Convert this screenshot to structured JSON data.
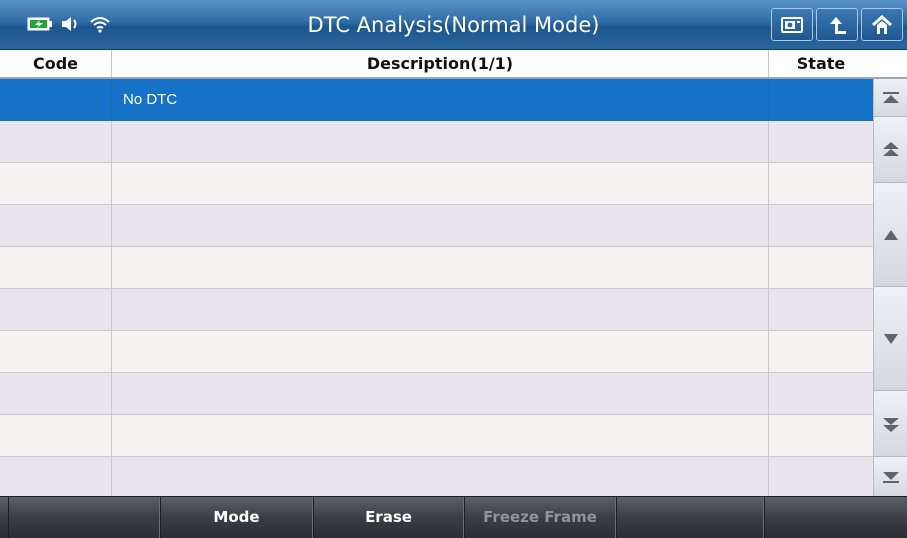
{
  "window": {
    "title": "DTC Analysis(Normal Mode)"
  },
  "status_icons": [
    "battery-icon",
    "speaker-icon",
    "wifi-icon"
  ],
  "title_buttons": [
    "screenshot-icon",
    "back-icon",
    "home-icon"
  ],
  "table": {
    "headers": {
      "code": "Code",
      "description": "Description(1/1)",
      "state": "State"
    },
    "rows": [
      {
        "code": "",
        "description": "No DTC",
        "state": "",
        "selected": true
      },
      {
        "code": "",
        "description": "",
        "state": ""
      },
      {
        "code": "",
        "description": "",
        "state": ""
      },
      {
        "code": "",
        "description": "",
        "state": ""
      },
      {
        "code": "",
        "description": "",
        "state": ""
      },
      {
        "code": "",
        "description": "",
        "state": ""
      },
      {
        "code": "",
        "description": "",
        "state": ""
      },
      {
        "code": "",
        "description": "",
        "state": ""
      },
      {
        "code": "",
        "description": "",
        "state": ""
      },
      {
        "code": "",
        "description": "",
        "state": ""
      }
    ]
  },
  "scrollbar": {
    "buttons": [
      "scroll-top-icon",
      "page-up-icon",
      "line-up-icon",
      "line-down-icon",
      "page-down-icon",
      "scroll-bottom-icon"
    ]
  },
  "toolbar": {
    "blank1": "",
    "mode": "Mode",
    "erase": "Erase",
    "freeze_frame": "Freeze Frame",
    "blank2": "",
    "blank3": ""
  },
  "colors": {
    "title_bar": "#2f6ba6",
    "selected_row": "#1672c6",
    "row_odd": "#e8e5ec",
    "row_even": "#f6f2f1",
    "toolbar": "#3a3e44",
    "disabled_text": "#8f949b"
  }
}
